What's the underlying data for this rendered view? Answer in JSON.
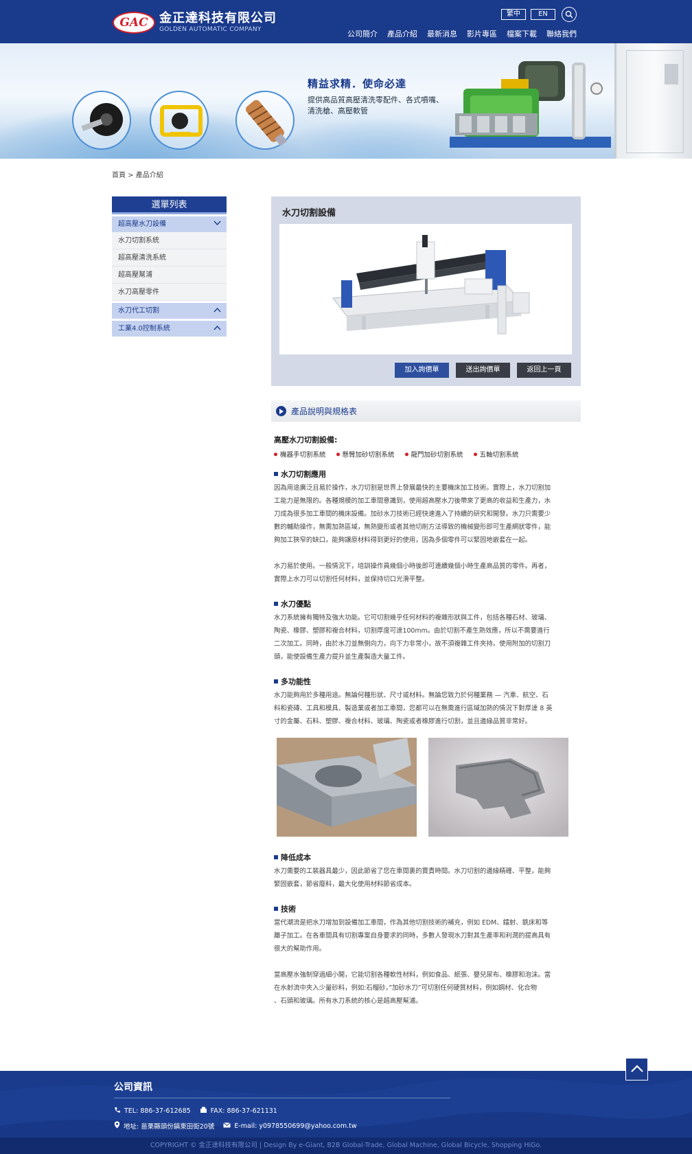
{
  "header": {
    "logo_mark": "GAC",
    "logo_cn": "金正達科技有限公司",
    "logo_en": "GOLDEN AUTOMATIC COMPANY",
    "lang_zh": "繁中",
    "lang_en": "EN",
    "nav": [
      "公司簡介",
      "產品介紹",
      "最新消息",
      "影片專區",
      "檔案下載",
      "聯絡我們"
    ]
  },
  "banner": {
    "headline": "精益求精．使命必達",
    "subtitle_line1": "提供高品質高壓清洗零配件、各式噴嘴、",
    "subtitle_line2": "清洗槍、高壓軟管"
  },
  "breadcrumb": "首頁 > 產品介紹",
  "sidebar": {
    "title": "選單列表",
    "cat1": "超高壓水刀設備",
    "items": [
      "水刀切割系統",
      "超高壓清洗系統",
      "超高壓幫浦",
      "水刀高壓零件"
    ],
    "cat2": "水刀代工切割",
    "cat3": "工業4.0控制系統"
  },
  "product": {
    "title": "水刀切割設備",
    "btn_add": "加入詢價單",
    "btn_send": "送出詢價單",
    "btn_back": "返回上一頁"
  },
  "spec_bar": "產品說明與規格表",
  "content": {
    "heading": "高壓水刀切割設備:",
    "bullets": [
      "機器手切割系統",
      "懸臂加砂切割系統",
      "龍門加砂切割系統",
      "五軸切割系統"
    ],
    "s1_title": "水刀切割應用",
    "s1_p1_l1": "因為用途廣泛且易於操作，水刀切割是世界上發展最快的主要機床加工技術。實際上，水刀切割加",
    "s1_p1_l2": "工能力是無限的。各種規模的加工車間意識到，使用超高壓水刀後帶來了更高的收益和生產力，水",
    "s1_p1_l3": "刀成為很多加工車間的機床設備。加砂水刀技術已經快速進入了持續的研究和開發。水刀只需要少",
    "s1_p1_l4": "數的輔助操作，無需加熱區域，無熱變形或者其他切削方法導致的機械變形即可生產網狀零件，能",
    "s1_p1_l5": "夠加工狹窄的缺口，能夠讓原材料得到更好的使用，因為多個零件可以緊固地嵌套在一起。",
    "s1_p2_l1": "水刀易於使用。一般情況下，培訓操作員幾個小時後即可連續幾個小時生產高品質的零件。再者，",
    "s1_p2_l2": "實際上水刀可以切割任何材料，並保持切口光滑平整。",
    "s2_title": "水刀優點",
    "s2_l1": "水刀系統擁有獨特及強大功能。它可切割幾乎任何材料的複雜形狀與工件，包括各種石材、玻璃、",
    "s2_l2": "陶瓷、橡膠、塑膠和複合材料，切割厚度可達100mm。由於切割不產生熱效應，所以不需要進行",
    "s2_l3": "二次加工。同時，由於水刀並無側向力，向下力非常小，故不須複雜工件夾持。使用附加的切割刀",
    "s2_l4": "頭，能使設備生產力提升並生產製造大量工件。",
    "s3_title": "多功能性",
    "s3_l1": "水刀能夠用於多種用途。無論何種形狀、尺寸或材料。無論您致力於何種業務 — 汽車、航空、石",
    "s3_l2": "料和瓷磚、工具和模具、製造業或者加工車間，您都可以在無需進行區域加熱的情況下對厚達 8 英",
    "s3_l3": "寸的金屬、石料、塑膠、複合材料、玻璃、陶瓷或者橡膠進行切割，並且邊緣品質非常好。",
    "s4_title": "降低成本",
    "s4_l1": "水刀需要的工裝器具最少，因此節省了您在車間裏的寶貴時間。水刀切割的邊緣精確、平整，能夠",
    "s4_l2": "緊固嵌套，節省廢料，最大化使用材料節省成本。",
    "s5_title": "技術",
    "s5_p1_l1": "當代潮流是把水刀增加到設備加工車間，作為其他切割技術的補充，例如 EDM、鐳射、銑床和等",
    "s5_p1_l2": "離子加工。在各車間具有切割專案自身要求的同時，多數人發現水刀對其生產率和利潤的提高具有",
    "s5_p1_l3": "很大的幫助作用。",
    "s5_p2_l1": "當高壓水強制穿過細小開，它能切割各種軟性材料，例如食品、紙張、嬰兒尿布、橡膠和泡沫。當",
    "s5_p2_l2": "在水射流中夾入少量砂料，例如:石榴砂，”加砂水刀”可切割任何硬質材料，例如鋼材、化合物",
    "s5_p2_l3": "、石頭和玻璃。所有水刀系統的核心是超高壓幫浦。"
  },
  "footer": {
    "title": "公司資訊",
    "tel": "TEL: 886-37-612685",
    "fax": "FAX: 886-37-621131",
    "address": "地址: 苗栗縣頭份鎮東田街20號",
    "email": "E-mail: y0978550699@yahoo.com.tw",
    "copyright": "COPYRIGHT © 金正達科技有限公司 | Design By  e-Giant, B2B Global-Trade, Global Machine, Global Bicycle, Shopping HiGo."
  },
  "colors": {
    "brand": "#1a3a8c",
    "accent_red": "#d21e2a",
    "side_cat": "#c5d2ef"
  }
}
